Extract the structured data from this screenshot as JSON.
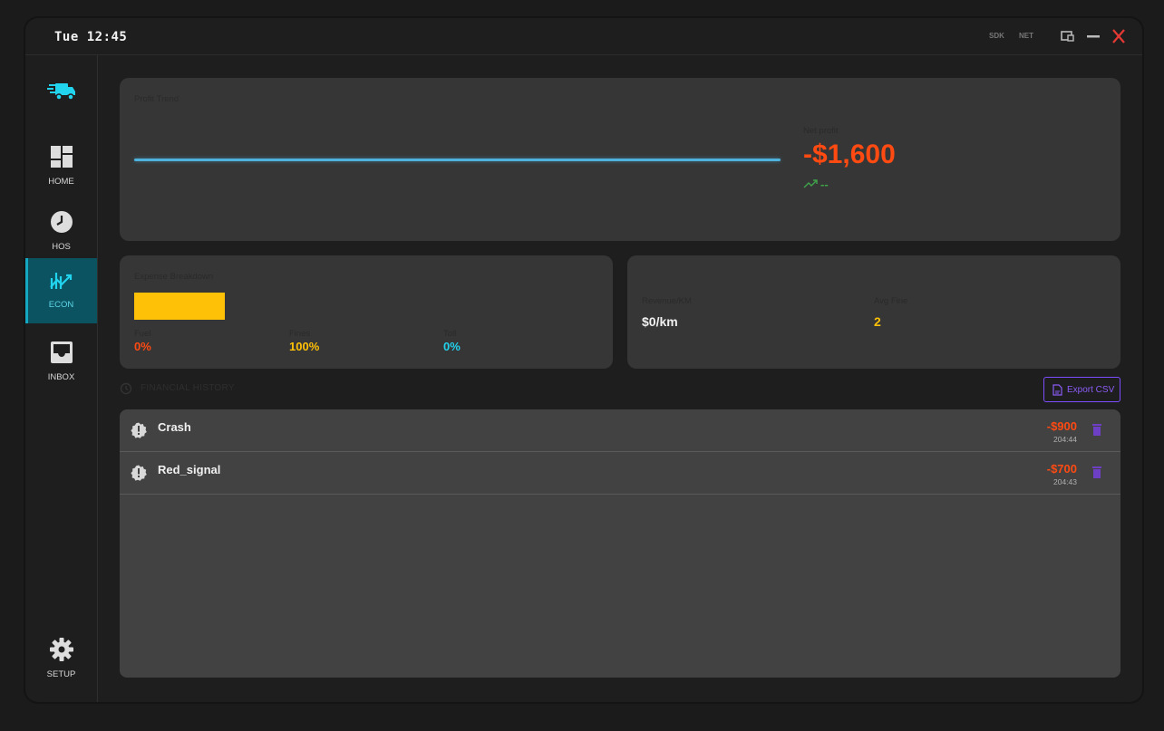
{
  "titlebar": {
    "clock": "Tue 12:45",
    "badges": [
      "SDK",
      "NET"
    ]
  },
  "sidebar": {
    "logo_icon": "truck-icon",
    "items": [
      {
        "label": "HOME",
        "icon": "dashboard-icon",
        "active": false
      },
      {
        "label": "HOS",
        "icon": "clock-icon",
        "active": false
      },
      {
        "label": "ECON",
        "icon": "trend-chart-icon",
        "active": true
      },
      {
        "label": "INBOX",
        "icon": "inbox-icon",
        "active": false
      },
      {
        "label": "SETUP",
        "icon": "gear-icon",
        "active": false
      }
    ]
  },
  "profit": {
    "title": "Profit Trend",
    "net_label": "Net profit",
    "net_value": "-$1,600",
    "trend_text": "--"
  },
  "expense": {
    "title": "Expense Breakdown",
    "fines_share": 1.0,
    "items": [
      {
        "label": "Fuel",
        "value": "0%",
        "color": "#ff4a12"
      },
      {
        "label": "Fines",
        "value": "100%",
        "color": "#ffc107"
      },
      {
        "label": "Toll",
        "value": "0%",
        "color": "#22d3ee"
      }
    ]
  },
  "metrics": {
    "revenue_label": "Revenue/KM",
    "revenue_value": "$0/km",
    "fine_label": "Avg Fine",
    "fine_value": "2"
  },
  "history": {
    "title": "FINANCIAL HISTORY",
    "export_label": "Export CSV",
    "rows": [
      {
        "name": "Crash",
        "amount": "-$900",
        "time": "204:44"
      },
      {
        "name": "Red_signal",
        "amount": "-$700",
        "time": "204:43"
      }
    ]
  },
  "colors": {
    "accent": "#14a7c2",
    "negative": "#ff4a12",
    "warning": "#ffc107",
    "export": "#7c4dff"
  }
}
